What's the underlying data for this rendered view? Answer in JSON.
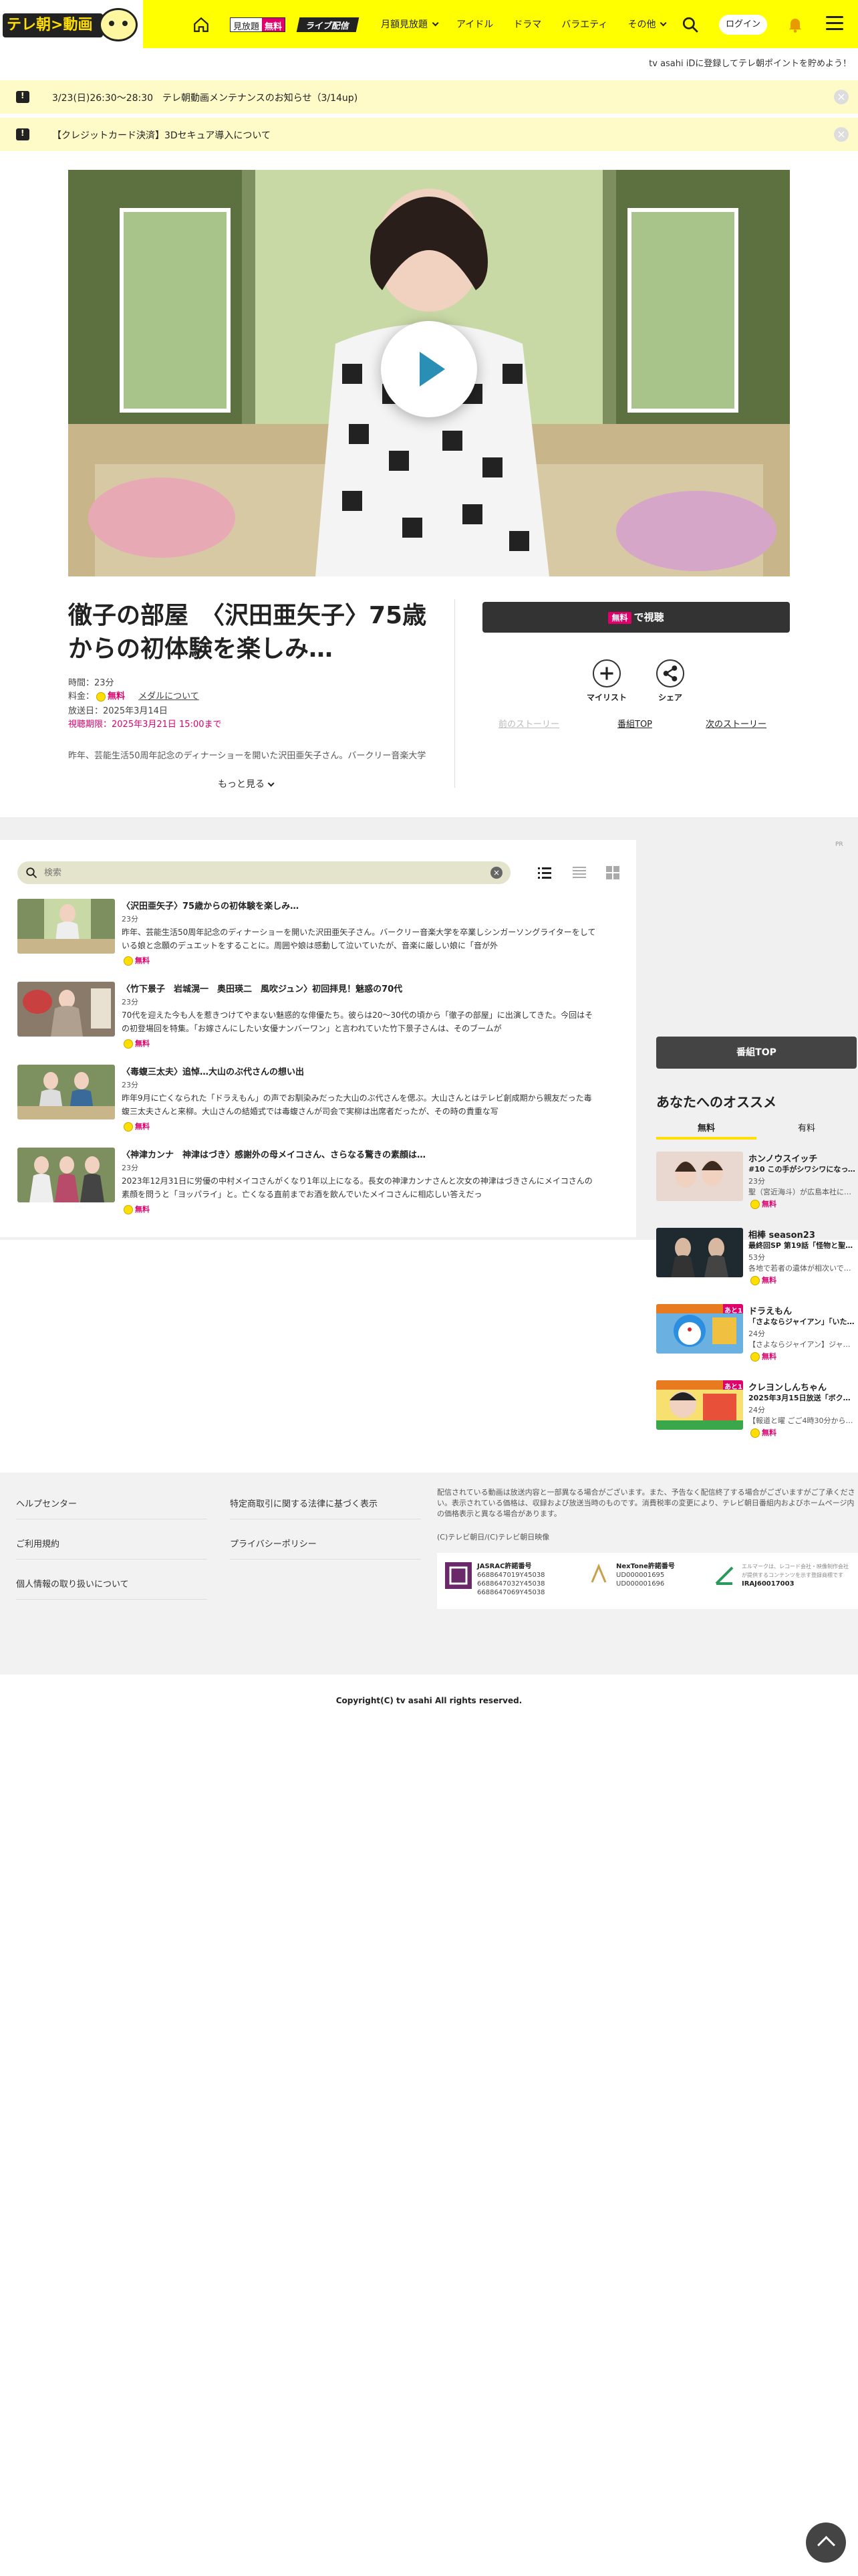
{
  "header": {
    "logo_text": "テレ朝",
    "logo_text2": "動画",
    "badge_mitahouda": "見放題",
    "badge_free": "無料",
    "badge_live": "ライブ配信",
    "nav": [
      {
        "label": "月額見放題",
        "dropdown": true
      },
      {
        "label": "アイドル",
        "dropdown": false
      },
      {
        "label": "ドラマ",
        "dropdown": false
      },
      {
        "label": "バラエティ",
        "dropdown": false
      },
      {
        "label": "その他",
        "dropdown": true
      }
    ],
    "login": "ログイン"
  },
  "promo_line": "tv asahi iDに登録してテレ朝ポイントを貯めよう！",
  "notices": [
    "3/23(日)26:30～28:30　テレ朝動画メンテナンスのお知らせ（3/14up)",
    "【クレジットカード決済】3Dセキュア導入について"
  ],
  "episode": {
    "title": "徹子の部屋　〈沢田亜矢子〉75歳からの初体験を楽しみ…",
    "duration": "時間：23分",
    "price_label": "料金：",
    "price_free": "無料",
    "medal_link": "メダルについて",
    "air_date": "放送日：2025年3月14日",
    "deadline": "視聴期限：2025年3月21日 15:00まで",
    "synopsis": "昨年、芸能生活50周年記念のディナーショーを開いた沢田亜矢子さん。バークリー音楽大学",
    "more": "もっと見る",
    "watch_tag": "無料",
    "watch_label": "で視聴",
    "mylist": "マイリスト",
    "share": "シェア",
    "prev_story": "前のストーリー",
    "program_top": "番組TOP",
    "next_story": "次のストーリー"
  },
  "list": {
    "search_placeholder": "検索",
    "items": [
      {
        "title": "〈沢田亜矢子〉75歳からの初体験を楽しみ…",
        "duration": "23分",
        "desc": "昨年、芸能生活50周年記念のディナーショーを開いた沢田亜矢子さん。バークリー音楽大学を卒業しシンガーソングライターをしている娘と念願のデュエットをすることに。周囲や娘は感動して泣いていたが、音楽に厳しい娘に「音が外",
        "free": "無料"
      },
      {
        "title": "〈竹下景子　岩城滉一　奥田瑛二　風吹ジュン〉初回拝見！魅惑の70代",
        "duration": "23分",
        "desc": "70代を迎えた今も人を惹きつけてやまない魅惑的な俳優たち。彼らは20～30代の頃から「徹子の部屋」に出演してきた。今回はその初登場回を特集。「お嫁さんにしたい女優ナンバーワン」と言われていた竹下景子さんは、そのブームが",
        "free": "無料"
      },
      {
        "title": "〈毒蝮三太夫〉追悼…大山のぶ代さんの想い出",
        "duration": "23分",
        "desc": "昨年9月に亡くなられた「ドラえもん」の声でお馴染みだった大山のぶ代さんを偲ぶ。大山さんとはテレビ創成期から親友だった毒蝮三太夫さんと来柳。大山さんの結婚式では毒蝮さんが司会で実柳は出席者だったが、その時の貴重な写",
        "free": "無料"
      },
      {
        "title": "〈神津カンナ　神津はづき〉感謝外の母メイコさん、さらなる驚きの素顔は…",
        "duration": "23分",
        "desc": "2023年12月31日に労優の中村メイコさんがくなり1年以上になる。長女の神津カンナさんと次女の神津はづきさんにメイコさんの素顔を問うと「ヨッパライ」と。亡くなる直前までお酒を飲んでいたメイコさんに相応しい答えだっ",
        "free": "無料"
      }
    ]
  },
  "sidebar": {
    "small_label": "PR",
    "program_top": "番組TOP",
    "rec_title": "あなたへのオススメ",
    "tab_free": "無料",
    "tab_paid": "有料",
    "items": [
      {
        "title": "ホンノウスイッチ",
        "sub": "#10 この手がシワシワになっても…",
        "duration": "23分",
        "desc": "聖（宮近海斗）が広島本社に…",
        "free": "無料",
        "badge": ""
      },
      {
        "title": "相棒 season23",
        "sub": "最終回SP 第19話「怪物と聖域」",
        "duration": "53分",
        "desc": "各地で若者の遺体が相次いで…",
        "free": "無料",
        "badge": ""
      },
      {
        "title": "ドラえもん",
        "sub": "「さよならジャイアン」「いたずらプ…",
        "duration": "24分",
        "desc": "【さよならジャイアン】ジャイ…",
        "free": "無料",
        "badge": "あと1日"
      },
      {
        "title": "クレヨンしんちゃん",
        "sub": "2025年3月15日放送「ボクの…",
        "duration": "24分",
        "desc": "【報道と曜 ごご4時30分から…",
        "free": "無料",
        "badge": "あと1日"
      }
    ]
  },
  "footer": {
    "links_left": [
      "ヘルプセンター",
      "ご利用規約",
      "個人情報の取り扱いについて"
    ],
    "links_right": [
      "特定商取引に関する法律に基づく表示",
      "プライバシーポリシー"
    ],
    "note": "配信されている動画は放送内容と一部異なる場合がございます。また、予告なく配信終了する場合がございますがご了承ください。表示されている価格は、収録および放送当時のものです。消費税率の変更により、テレビ朝日番組内およびホームページ内の価格表示と異なる場合があります。",
    "note2": "(C)テレビ朝日/(C)テレビ朝日映像",
    "licenses": [
      {
        "name": "JASRAC許諾番号",
        "nums": "6688647019Y45038\n6688647032Y45038\n6688647069Y45038"
      },
      {
        "name": "NexTone許諾番号",
        "nums": "UD000001695\nUD000001696"
      },
      {
        "name": "IRAJ60017003",
        "nums": "エルマークは、レコード会社・映像制作会社が提供するコンテンツを示す登録商標です"
      }
    ],
    "copyright": "Copyright(C) tv asahi All rights reserved."
  }
}
